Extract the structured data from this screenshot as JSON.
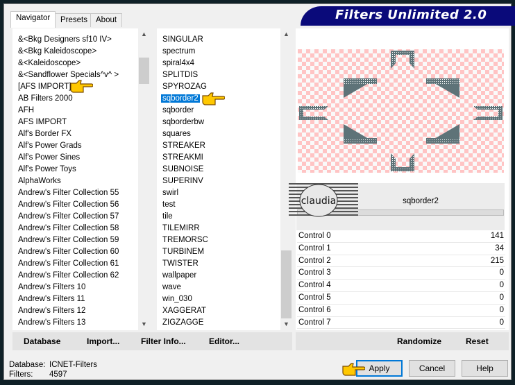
{
  "window": {
    "title": "Filters Unlimited 2.0"
  },
  "tabs": [
    {
      "label": "Navigator",
      "active": true
    },
    {
      "label": "Presets"
    },
    {
      "label": "About"
    }
  ],
  "categories": [
    "&<Bkg Designers sf10 IV>",
    "&<Bkg Kaleidoscope>",
    "&<Kaleidoscope>",
    "&<Sandflower Specials^v^ >",
    "[AFS IMPORT]",
    "AB Filters 2000",
    "AFH",
    "AFS IMPORT",
    "Alf's Border FX",
    "Alf's Power Grads",
    "Alf's Power Sines",
    "Alf's Power Toys",
    "AlphaWorks",
    "Andrew's Filter Collection 55",
    "Andrew's Filter Collection 56",
    "Andrew's Filter Collection 57",
    "Andrew's Filter Collection 58",
    "Andrew's Filter Collection 59",
    "Andrew's Filter Collection 60",
    "Andrew's Filter Collection 61",
    "Andrew's Filter Collection 62",
    "Andrew's Filters 10",
    "Andrew's Filters 11",
    "Andrew's Filters 12",
    "Andrew's Filters 13"
  ],
  "selected_category": "[AFS IMPORT]",
  "filters": [
    "SINGULAR",
    "spectrum",
    "spiral4x4",
    "SPLITDIS",
    "SPYROZAG",
    "sqborder2",
    "sqborder",
    "sqborderbw",
    "squares",
    "STREAKER",
    "STREAKMI",
    "SUBNOISE",
    "SUPERINV",
    "swirl",
    "test",
    "tile",
    "TILEMIRR",
    "TREMORSC",
    "TURBINEM",
    "TWISTER",
    "wallpaper",
    "wave",
    "win_030",
    "XAGGERAT",
    "ZIGZAGGE"
  ],
  "selected_filter": "sqborder2",
  "filter_name": "sqborder2",
  "watermark": "claudia",
  "controls": [
    {
      "label": "Control 0",
      "value": "141"
    },
    {
      "label": "Control 1",
      "value": "34"
    },
    {
      "label": "Control 2",
      "value": "215"
    },
    {
      "label": "Control 3",
      "value": "0"
    },
    {
      "label": "Control 4",
      "value": "0"
    },
    {
      "label": "Control 5",
      "value": "0"
    },
    {
      "label": "Control 6",
      "value": "0"
    },
    {
      "label": "Control 7",
      "value": "0"
    }
  ],
  "left_buttons": {
    "database": "Database",
    "import": "Import...",
    "filter_info": "Filter Info...",
    "editor": "Editor..."
  },
  "right_buttons": {
    "randomize": "Randomize",
    "reset": "Reset"
  },
  "status": {
    "database_label": "Database:",
    "database_value": "ICNET-Filters",
    "filters_label": "Filters:",
    "filters_value": "4597"
  },
  "dialog_buttons": {
    "apply": "Apply",
    "cancel": "Cancel",
    "help": "Help"
  },
  "colors": {
    "title_bar": "#0a0a7a",
    "selection": "#0078d7",
    "checker": "#ffc4c4",
    "shape": "#5e7378"
  }
}
